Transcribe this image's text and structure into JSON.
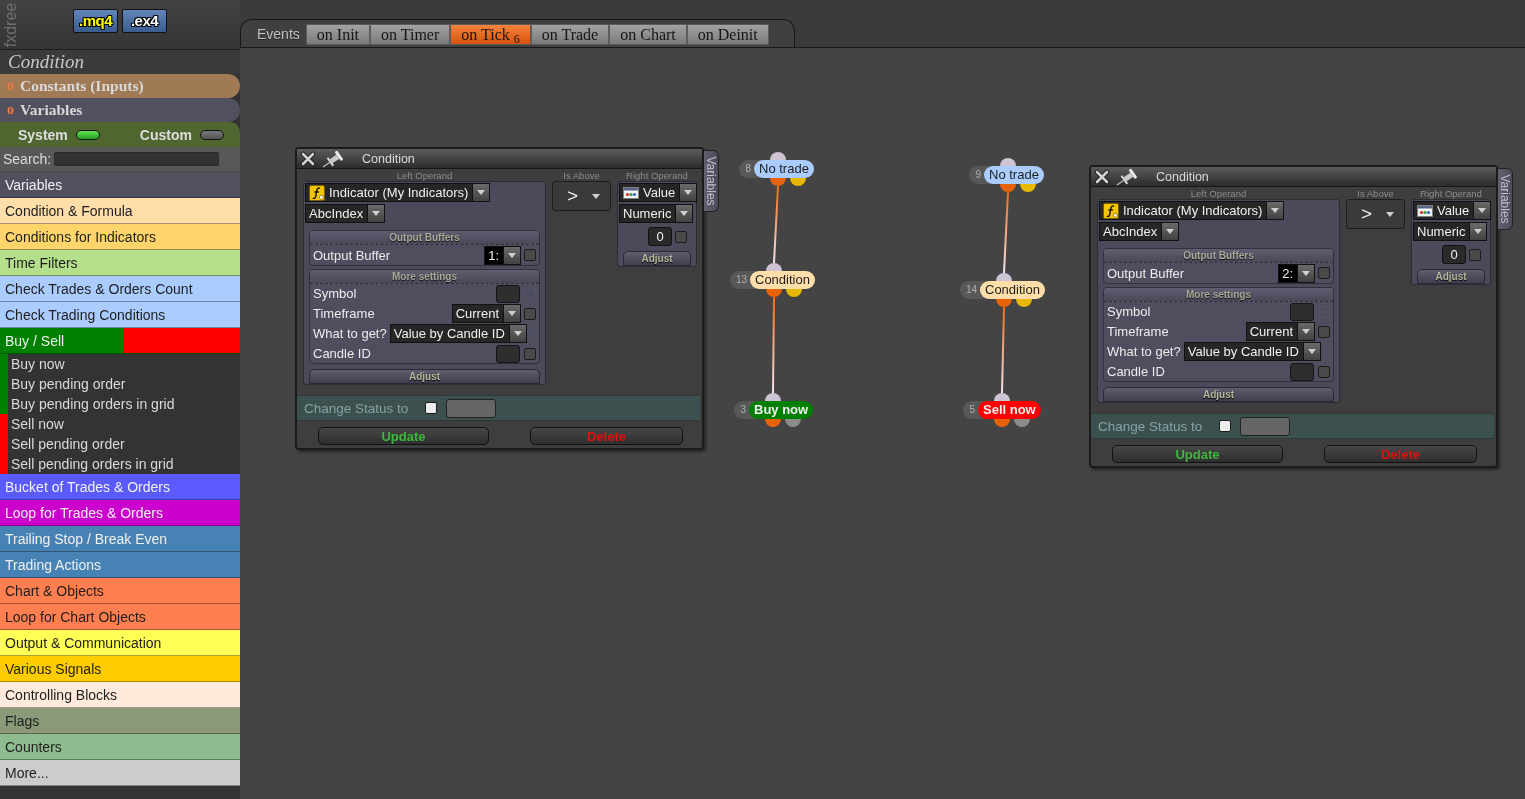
{
  "sidebar": {
    "logo": "fxdree",
    "file_buttons": [
      {
        "label": ".mq4",
        "kind": "source"
      },
      {
        "label": ".ex4",
        "kind": "compiled"
      }
    ],
    "title": "Condition",
    "sections": [
      {
        "bullet": "o",
        "label": "Constants (Inputs)",
        "color": "#a07a55"
      },
      {
        "bullet": "o",
        "label": "Variables",
        "color": "#50505f"
      }
    ],
    "toggles": [
      {
        "label": "System",
        "on": true
      },
      {
        "label": "Custom",
        "on": false
      }
    ],
    "search": {
      "label": "Search:"
    },
    "categories": [
      {
        "label": "Variables",
        "color": "#50505f"
      },
      {
        "label": "Condition & Formula",
        "color": "#ffdeaa"
      },
      {
        "label": "Conditions for Indicators",
        "color": "#ffd56b"
      },
      {
        "label": "Time Filters",
        "color": "#b4e08c"
      },
      {
        "label": "Check Trades & Orders Count",
        "color": "#aaccff"
      },
      {
        "label": "Check Trading Conditions",
        "color": "#aaccff"
      },
      {
        "label": "Buy / Sell",
        "color": "#008000",
        "children": [
          {
            "label": "Buy now",
            "color": "#008000"
          },
          {
            "label": "Buy pending order",
            "color": "#008000"
          },
          {
            "label": "Buy pending orders in grid",
            "color": "#008000"
          },
          {
            "label": "Sell now",
            "color": "#ff0000"
          },
          {
            "label": "Sell pending order",
            "color": "#ff0000"
          },
          {
            "label": "Sell pending orders in grid",
            "color": "#ff0000"
          }
        ]
      },
      {
        "label": "Bucket of Trades & Orders",
        "color": "#5a5aff"
      },
      {
        "label": "Loop for Trades & Orders",
        "color": "#cc00cc"
      },
      {
        "label": "Trailing Stop / Break Even",
        "color": "#4682b4"
      },
      {
        "label": "Trading Actions",
        "color": "#4682b4"
      },
      {
        "label": "Chart & Objects",
        "color": "#ff7f50"
      },
      {
        "label": "Loop for Chart Objects",
        "color": "#ff7f50"
      },
      {
        "label": "Output & Communication",
        "color": "#ffff55"
      },
      {
        "label": "Various Signals",
        "color": "#ffcc00"
      },
      {
        "label": "Controlling Blocks",
        "color": "#ffeadc"
      },
      {
        "label": "Flags",
        "color": "#8a9a78"
      },
      {
        "label": "Counters",
        "color": "#8fbc8f"
      },
      {
        "label": "More...",
        "color": "#cccccc"
      }
    ]
  },
  "events": {
    "label": "Events",
    "tabs": [
      {
        "label": "on Init",
        "selected": false
      },
      {
        "label": "on Timer",
        "selected": false
      },
      {
        "label": "on Tick",
        "count": "6",
        "selected": true
      },
      {
        "label": "on Trade",
        "selected": false
      },
      {
        "label": "on Chart",
        "selected": false
      },
      {
        "label": "on Deinit",
        "selected": false
      }
    ]
  },
  "canvas": {
    "dialogs": [
      {
        "title": "Condition",
        "side_tab": "Variables",
        "left_operand": {
          "label": "Left Operand",
          "source": "Indicator (My Indicators)",
          "indicator": "AbcIndex",
          "output_buffers": {
            "title": "Output Buffers",
            "label": "Output Buffer",
            "value": "1:",
            "checked": false
          },
          "more_settings": {
            "title": "More settings",
            "rows": [
              {
                "label": "Symbol",
                "kind": "field",
                "checkbox_disabled": true,
                "checked": false
              },
              {
                "label": "Timeframe",
                "kind": "select",
                "value": "Current",
                "checkbox_disabled": false,
                "checked": false
              },
              {
                "label": "What to get?",
                "kind": "select",
                "value": "Value by Candle ID",
                "checkbox_disabled": true,
                "checked": false
              },
              {
                "label": "Candle ID",
                "kind": "field",
                "checkbox_disabled": false,
                "checked": false
              }
            ]
          },
          "adjust": "Adjust"
        },
        "operator": {
          "label": "Is Above",
          "value": ">"
        },
        "right_operand": {
          "label": "Right Operand",
          "source": "Value",
          "type": "Numeric",
          "value": "0",
          "checked": false,
          "adjust": "Adjust"
        },
        "change_status": {
          "label": "Change Status to",
          "checked": false
        },
        "buttons": [
          {
            "label": "Update",
            "kind": "update"
          },
          {
            "label": "Delete",
            "kind": "delete"
          }
        ]
      },
      {
        "title": "Condition",
        "side_tab": "Variables",
        "left_operand": {
          "label": "Left Operand",
          "source": "Indicator (My Indicators)",
          "indicator": "AbcIndex",
          "output_buffers": {
            "title": "Output Buffers",
            "label": "Output Buffer",
            "value": "2:",
            "checked": false
          },
          "more_settings": {
            "title": "More settings",
            "rows": [
              {
                "label": "Symbol",
                "kind": "field",
                "checkbox_disabled": true,
                "checked": false
              },
              {
                "label": "Timeframe",
                "kind": "select",
                "value": "Current",
                "checkbox_disabled": false,
                "checked": false
              },
              {
                "label": "What to get?",
                "kind": "select",
                "value": "Value by Candle ID",
                "checkbox_disabled": true,
                "checked": false
              },
              {
                "label": "Candle ID",
                "kind": "field",
                "checkbox_disabled": false,
                "checked": false
              }
            ]
          },
          "adjust": "Adjust"
        },
        "operator": {
          "label": "Is Above",
          "value": ">"
        },
        "right_operand": {
          "label": "Right Operand",
          "source": "Value",
          "type": "Numeric",
          "value": "0",
          "checked": false,
          "adjust": "Adjust"
        },
        "change_status": {
          "label": "Change Status to",
          "checked": false
        },
        "buttons": [
          {
            "label": "Update",
            "kind": "update"
          },
          {
            "label": "Delete",
            "kind": "delete"
          }
        ]
      }
    ],
    "flows": [
      {
        "nodes": [
          {
            "number": "8",
            "label": "No trade",
            "color": "#aaccff",
            "kind": "block"
          },
          {
            "number": "13",
            "label": "Condition",
            "color": "#ffdeaa",
            "kind": "block"
          },
          {
            "number": "3",
            "label": "Buy now",
            "color": "#008000",
            "kind": "action"
          }
        ]
      },
      {
        "nodes": [
          {
            "number": "9",
            "label": "No trade",
            "color": "#aaccff",
            "kind": "block"
          },
          {
            "number": "14",
            "label": "Condition",
            "color": "#ffdeaa",
            "kind": "block"
          },
          {
            "number": "5",
            "label": "Sell now",
            "color": "#ff0000",
            "kind": "action"
          }
        ]
      }
    ]
  }
}
